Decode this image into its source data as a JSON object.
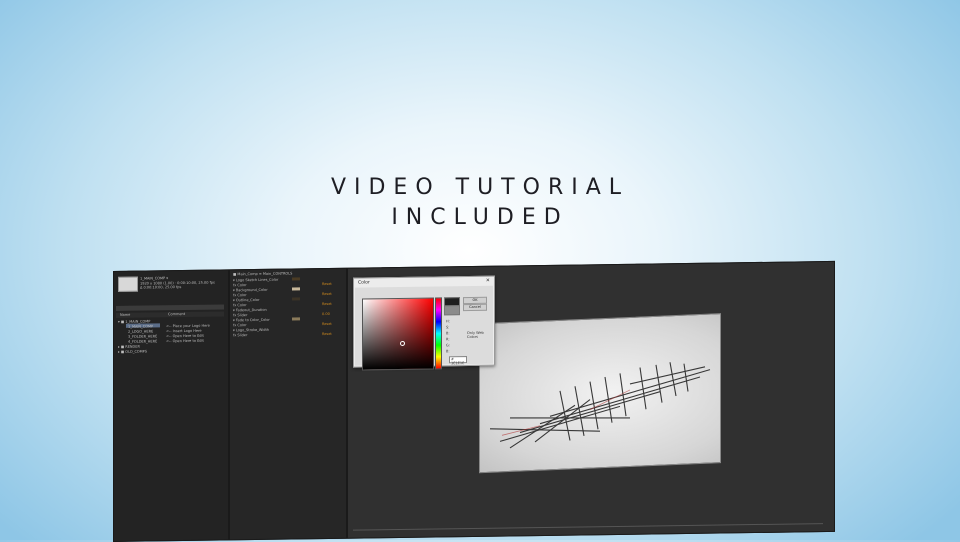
{
  "headline": {
    "line1": "VIDEO TUTORIAL",
    "line2": "INCLUDED"
  },
  "project_panel": {
    "comp_name": "1_MAIN_COMP ▾",
    "comp_info_1": "1920 x 1080 (1.00) · 0:00:10:00, 25.00 fps",
    "comp_info_2": "Δ 0:00:10:00, 25.00 fps",
    "col_name": "Name",
    "col_comment": "Comment",
    "items": [
      {
        "label": "▾ ■ 1_MAIN_COMP",
        "comment": ""
      },
      {
        "label": "1_MAIN_COMP",
        "comment": "<-- Place your Logo Here",
        "selected": true
      },
      {
        "label": "2_LOGO_HERE",
        "comment": "<-- Insert Logo Here"
      },
      {
        "label": "3_FOLDER_HERE",
        "comment": "<-- Open Here to Edit"
      },
      {
        "label": "4_FOLDER_HERE",
        "comment": "<-- Open Here to Edit"
      },
      {
        "label": "▸ ■ RENDER",
        "comment": ""
      },
      {
        "label": "▸ ■ OLD_COMPS",
        "comment": ""
      }
    ]
  },
  "timeline_panel": {
    "tab": "■ Main_Comp ≡  Main_CONTROLS",
    "rows": [
      {
        "label": "▾ Logo Sketch Lines_Color",
        "value": "",
        "swatch": "#4a3b24"
      },
      {
        "label": "  fx Color",
        "value": "Reset",
        "swatch": ""
      },
      {
        "label": "▾ Background_Color",
        "value": "",
        "swatch": "#c8b89a"
      },
      {
        "label": "  fx Color",
        "value": "Reset",
        "swatch": ""
      },
      {
        "label": "▾ Outline_Color",
        "value": "",
        "swatch": "#3b3326"
      },
      {
        "label": "  fx Color",
        "value": "Reset",
        "swatch": ""
      },
      {
        "label": "▾ Fadeout_Duration",
        "value": "",
        "swatch": ""
      },
      {
        "label": "  fx Slider",
        "value": "0.00",
        "swatch": ""
      },
      {
        "label": "▾ Fade to Color_Color",
        "value": "",
        "swatch": "#8a7a5a"
      },
      {
        "label": "  fx Color",
        "value": "Reset",
        "swatch": ""
      },
      {
        "label": "▾ Logo_Stroke_Width",
        "value": "",
        "swatch": ""
      },
      {
        "label": "  fx Slider",
        "value": "Reset",
        "swatch": ""
      }
    ]
  },
  "color_dialog": {
    "title": "Color",
    "close": "✕",
    "ok_label": "OK",
    "cancel_label": "Cancel",
    "labels": [
      "H:",
      "S:",
      "B:",
      "R:",
      "G:",
      "B:"
    ],
    "only_web_colors": "Only Web Colors",
    "hex_value": "# 1E1E1E"
  },
  "colors": {
    "accent_orange": "#d08a1e",
    "selection": "#5b6d88",
    "panel_bg": "#232323"
  }
}
